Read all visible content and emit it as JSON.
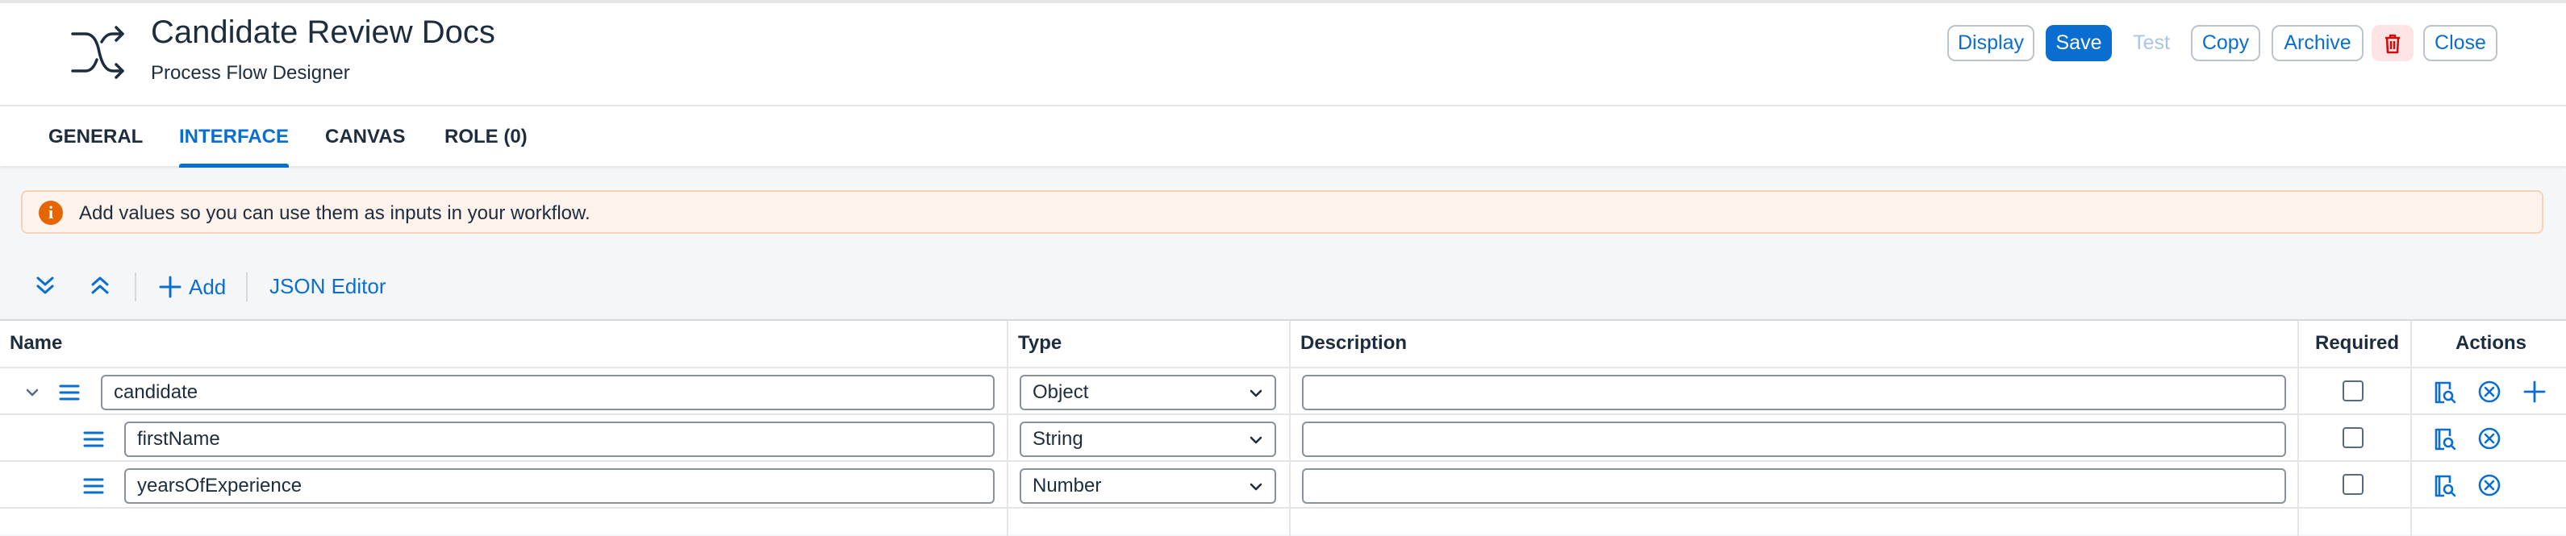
{
  "header": {
    "title": "Candidate Review Docs",
    "subtitle": "Process Flow Designer",
    "app_icon": "shuffle-icon",
    "buttons": {
      "display": "Display",
      "save": "Save",
      "test": "Test",
      "copy": "Copy",
      "archive": "Archive",
      "delete_icon": "trash-icon",
      "close": "Close"
    }
  },
  "tabs": [
    {
      "label": "GENERAL"
    },
    {
      "label": "INTERFACE",
      "active": true
    },
    {
      "label": "CANVAS"
    },
    {
      "label": "ROLE (0)"
    }
  ],
  "message": {
    "type": "warning",
    "text": "Add values so you can use them as inputs in your workflow."
  },
  "toolbar": {
    "expand_all_icon": "double-chevron-down-icon",
    "collapse_all_icon": "double-chevron-up-icon",
    "add_label": "Add",
    "json_editor_label": "JSON Editor"
  },
  "table": {
    "columns": {
      "name": "Name",
      "type": "Type",
      "description": "Description",
      "required": "Required",
      "actions": "Actions"
    },
    "rows": [
      {
        "name": "candidate",
        "type": "Object",
        "description": "",
        "required": false,
        "expanded": true,
        "level": 0
      },
      {
        "name": "firstName",
        "type": "String",
        "description": "",
        "required": false,
        "level": 1
      },
      {
        "name": "yearsOfExperience",
        "type": "Number",
        "description": "",
        "required": false,
        "level": 1
      }
    ]
  },
  "colors": {
    "accent": "#0a6ed1",
    "warning": "#e76500",
    "warning_bg": "#fef3ec",
    "danger_bg": "#fde3e3"
  }
}
